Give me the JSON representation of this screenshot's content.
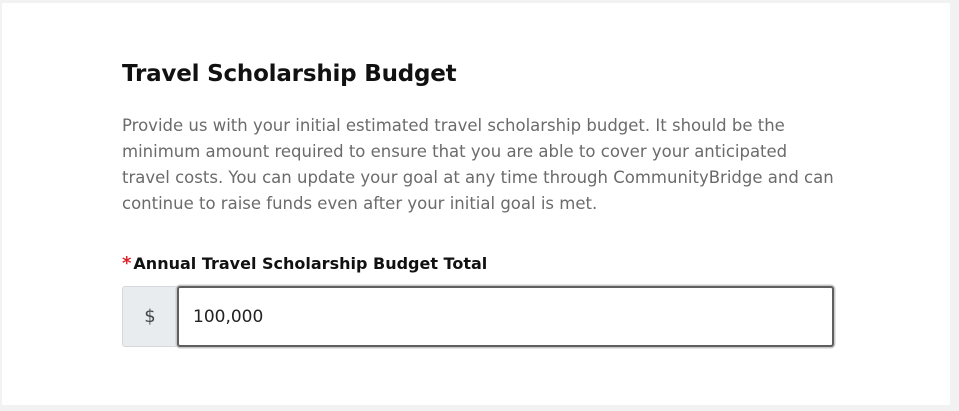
{
  "section": {
    "title": "Travel Scholarship Budget",
    "description": "Provide us with your initial estimated travel scholarship budget. It should be the minimum amount required to ensure that you are able to cover your anticipated travel costs. You can update your goal at any time through CommunityBridge and can continue to raise funds even after your initial goal is met."
  },
  "budget_field": {
    "required_marker": "*",
    "label": "Annual Travel Scholarship Budget Total",
    "currency_prefix": "$",
    "value": "100,000"
  },
  "colors": {
    "required": "#d9232d",
    "title": "#111111",
    "description": "#6b6b6b"
  }
}
